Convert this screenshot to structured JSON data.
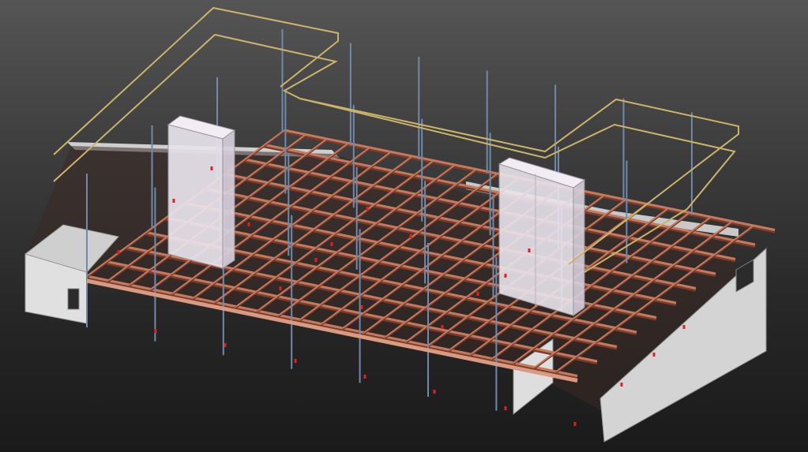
{
  "scene": {
    "type": "3d-bim-model-view",
    "icons": {
      "model": "building-structure-model-icon"
    },
    "colors": {
      "background_top": "#555555",
      "background_bottom": "#1a1a1a",
      "beam": "#c47a5e",
      "beam_edge": "#7a3b2a",
      "column": "#6f8aaa",
      "wall": "#d9d9d9",
      "core": "#e8e3ea",
      "rail": "#c8b36a",
      "marker": "#e02020"
    }
  }
}
